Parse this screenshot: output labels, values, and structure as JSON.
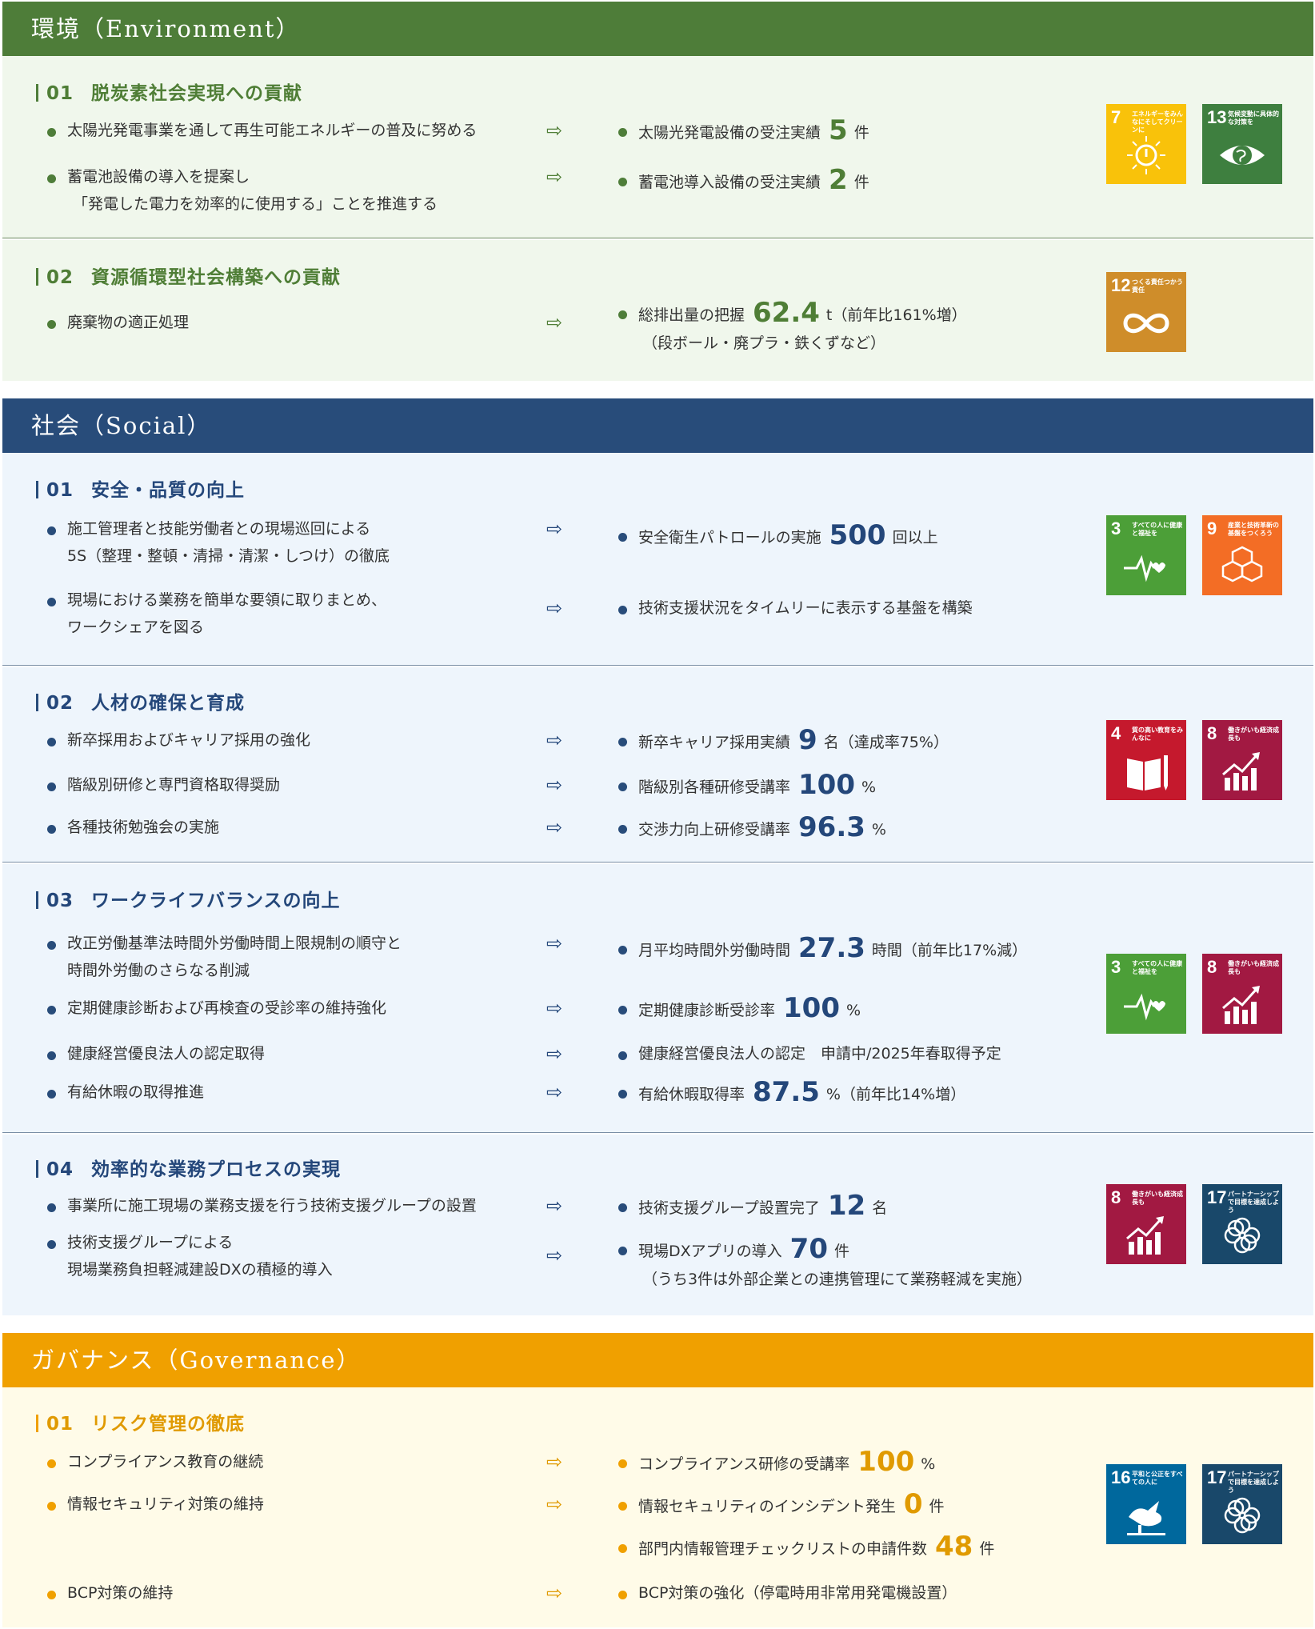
{
  "environment": {
    "header": "環境（Environment）",
    "color": "#4e7d39",
    "sub1": {
      "num": "01",
      "title": "脱炭素社会実現への貢献",
      "left1": "太陽光発電事業を通して再生可能エネルギーの普及に努める",
      "left2a": "蓄電池設備の導入を提案し",
      "left2b": "「発電した電力を効率的に使用する」ことを推進する",
      "right1_label": "太陽光発電設備の受注実績",
      "right1_value": "5",
      "right1_unit": "件",
      "right2_label": "蓄電池導入設備の受注実績",
      "right2_value": "2",
      "right2_unit": "件",
      "sdg_a": {
        "num": "7",
        "label": "エネルギーをみんなにそしてクリーンに",
        "color": "#f9c20a",
        "icon": "sun-power-icon"
      },
      "sdg_b": {
        "num": "13",
        "label": "気候変動に具体的な対策を",
        "color": "#3e7f3f",
        "icon": "eye-earth-icon"
      }
    },
    "sub2": {
      "num": "02",
      "title": "資源循環型社会構築への貢献",
      "left1": "廃棄物の適正処理",
      "right1_label": "総排出量の把握",
      "right1_value": "62.4",
      "right1_unit": "t（前年比161%増）",
      "right1_note": "（段ボール・廃プラ・鉄くずなど）",
      "sdg_a": {
        "num": "12",
        "label": "つくる責任つかう責任",
        "color": "#cf8d2a",
        "icon": "infinity-icon"
      }
    }
  },
  "social": {
    "header": "社会（Social）",
    "color": "#284c7a",
    "sub1": {
      "num": "01",
      "title": "安全・品質の向上",
      "left1a": "施工管理者と技能労働者との現場巡回による",
      "left1b": "5S（整理・整頓・清掃・清潔・しつけ）の徹底",
      "left2a": "現場における業務を簡単な要領に取りまとめ、",
      "left2b": "ワークシェアを図る",
      "right1_label": "安全衛生パトロールの実施",
      "right1_value": "500",
      "right1_unit": "回以上",
      "right2_label": "技術支援状況をタイムリーに表示する基盤を構築",
      "sdg_a": {
        "num": "3",
        "label": "すべての人に健康と福祉を",
        "color": "#4c9f38",
        "icon": "heartbeat-icon"
      },
      "sdg_b": {
        "num": "9",
        "label": "産業と技術革新の基盤をつくろう",
        "color": "#f36d25",
        "icon": "cubes-icon"
      }
    },
    "sub2": {
      "num": "02",
      "title": "人材の確保と育成",
      "left1": "新卒採用およびキャリア採用の強化",
      "left2": "階級別研修と専門資格取得奨励",
      "left3": "各種技術勉強会の実施",
      "right1_label": "新卒キャリア採用実績",
      "right1_value": "9",
      "right1_unit": "名（達成率75%）",
      "right2_label": "階級別各種研修受講率",
      "right2_value": "100",
      "right2_unit": "%",
      "right3_label": "交渉力向上研修受講率",
      "right3_value": "96.3",
      "right3_unit": "%",
      "sdg_a": {
        "num": "4",
        "label": "質の高い教育をみんなに",
        "color": "#c5192d",
        "icon": "book-pencil-icon"
      },
      "sdg_b": {
        "num": "8",
        "label": "働きがいも経済成長も",
        "color": "#a21942",
        "icon": "growth-chart-icon"
      }
    },
    "sub3": {
      "num": "03",
      "title": "ワークライフバランスの向上",
      "left1a": "改正労働基準法時間外労働時間上限規制の順守と",
      "left1b": "時間外労働のさらなる削減",
      "left2": "定期健康診断および再検査の受診率の維持強化",
      "left3": "健康経営優良法人の認定取得",
      "left4": "有給休暇の取得推進",
      "right1_label": "月平均時間外労働時間",
      "right1_value": "27.3",
      "right1_unit": "時間（前年比17%減）",
      "right2_label": "定期健康診断受診率",
      "right2_value": "100",
      "right2_unit": "%",
      "right3_label": "健康経営優良法人の認定　申請中/2025年春取得予定",
      "right4_label": "有給休暇取得率",
      "right4_value": "87.5",
      "right4_unit": "%（前年比14%増）",
      "sdg_a": {
        "num": "3",
        "label": "すべての人に健康と福祉を",
        "color": "#4c9f38",
        "icon": "heartbeat-icon"
      },
      "sdg_b": {
        "num": "8",
        "label": "働きがいも経済成長も",
        "color": "#a21942",
        "icon": "growth-chart-icon"
      }
    },
    "sub4": {
      "num": "04",
      "title": "効率的な業務プロセスの実現",
      "left1": "事業所に施工現場の業務支援を行う技術支援グループの設置",
      "left2a": "技術支援グループによる",
      "left2b": "現場業務負担軽減建設DXの積極的導入",
      "right1_label": "技術支援グループ設置完了",
      "right1_value": "12",
      "right1_unit": "名",
      "right2_label": "現場DXアプリの導入",
      "right2_value": "70",
      "right2_unit": "件",
      "right2_note": "（うち3件は外部企業との連携管理にて業務軽減を実施）",
      "sdg_a": {
        "num": "8",
        "label": "働きがいも経済成長も",
        "color": "#a21942",
        "icon": "growth-chart-icon"
      },
      "sdg_b": {
        "num": "17",
        "label": "パートナーシップで目標を達成しよう",
        "color": "#19486a",
        "icon": "flower-rings-icon"
      }
    }
  },
  "governance": {
    "header": "ガバナンス（Governance）",
    "color": "#f0a000",
    "sub1": {
      "num": "01",
      "title": "リスク管理の徹底",
      "left1": "コンプライアンス教育の継続",
      "left2": "情報セキュリティ対策の維持",
      "left3": "BCP対策の維持",
      "right1_label": "コンプライアンス研修の受講率",
      "right1_value": "100",
      "right1_unit": "%",
      "right2_label": "情報セキュリティのインシデント発生",
      "right2_value": "0",
      "right2_unit": "件",
      "right3_label": "部門内情報管理チェックリストの申請件数",
      "right3_value": "48",
      "right3_unit": "件",
      "right4_label": "BCP対策の強化（停電時用非常用発電機設置）",
      "sdg_a": {
        "num": "16",
        "label": "平和と公正をすべての人に",
        "color": "#00689d",
        "icon": "dove-icon"
      },
      "sdg_b": {
        "num": "17",
        "label": "パートナーシップで目標を達成しよう",
        "color": "#19486a",
        "icon": "flower-rings-icon"
      }
    }
  },
  "arrow_glyph": "⇨"
}
